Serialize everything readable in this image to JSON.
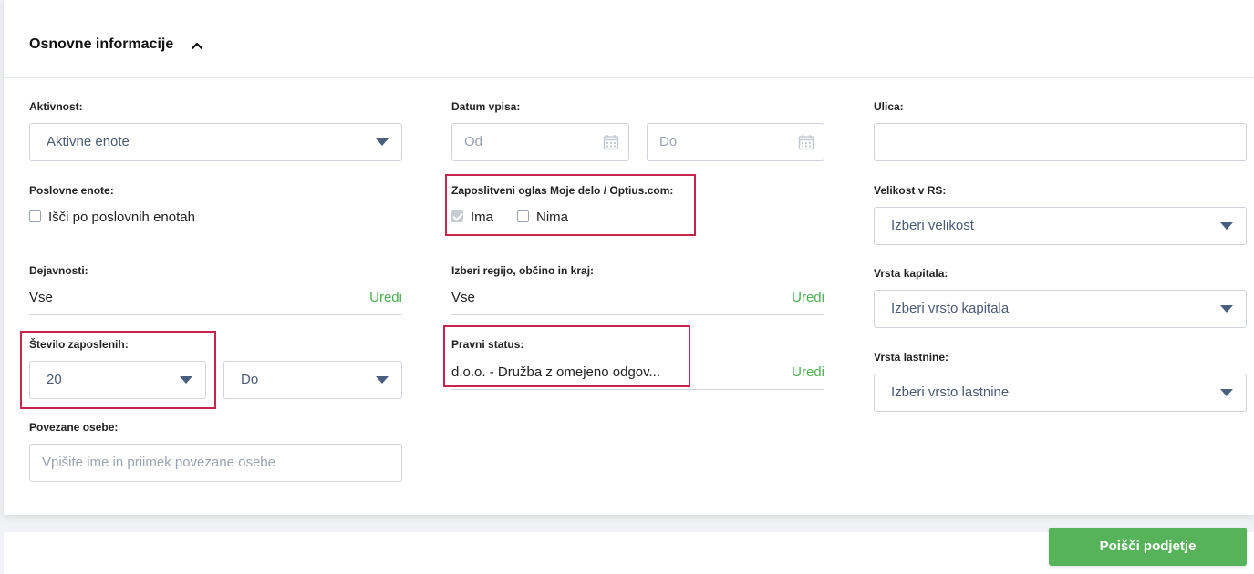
{
  "section": {
    "title": "Osnovne informacije"
  },
  "aktivnost": {
    "label": "Aktivnost:",
    "value": "Aktivne enote"
  },
  "poslovne_enote": {
    "label": "Poslovne enote:",
    "checkbox_label": "Išči po poslovnih enotah"
  },
  "dejavnosti": {
    "label": "Dejavnosti:",
    "value": "Vse",
    "edit": "Uredi"
  },
  "stevilo_zaposlenih": {
    "label": "Število zaposlenih:",
    "from_value": "20",
    "to_value": "Do"
  },
  "povezane_osebe": {
    "label": "Povezane osebe:",
    "placeholder": "Vpišite ime in priimek povezane osebe"
  },
  "datum_vpisa": {
    "label": "Datum vpisa:",
    "from_placeholder": "Od",
    "to_placeholder": "Do"
  },
  "zaposlitveni_oglas": {
    "label": "Zaposlitveni oglas Moje delo / Optius.com:",
    "option_yes": "Ima",
    "option_no": "Nima"
  },
  "regija": {
    "label": "Izberi regijo, občino in kraj:",
    "value": "Vse",
    "edit": "Uredi"
  },
  "pravni_status": {
    "label": "Pravni status:",
    "value": "d.o.o. - Družba z omejeno odgov...",
    "edit": "Uredi"
  },
  "ulica": {
    "label": "Ulica:",
    "value": ""
  },
  "velikost": {
    "label": "Velikost v RS:",
    "value": "Izberi velikost"
  },
  "vrsta_kapitala": {
    "label": "Vrsta kapitala:",
    "value": "Izberi vrsto kapitala"
  },
  "vrsta_lastnine": {
    "label": "Vrsta lastnine:",
    "value": "Izberi vrsto lastnine"
  },
  "actions": {
    "search_label": "Poišči podjetje"
  },
  "colors": {
    "accent_green": "#56b35a",
    "highlight_red": "#c8254e",
    "link_green": "#4caf50"
  },
  "icons": [
    "chevron-up-icon",
    "caret-down-icon",
    "calendar-icon"
  ]
}
